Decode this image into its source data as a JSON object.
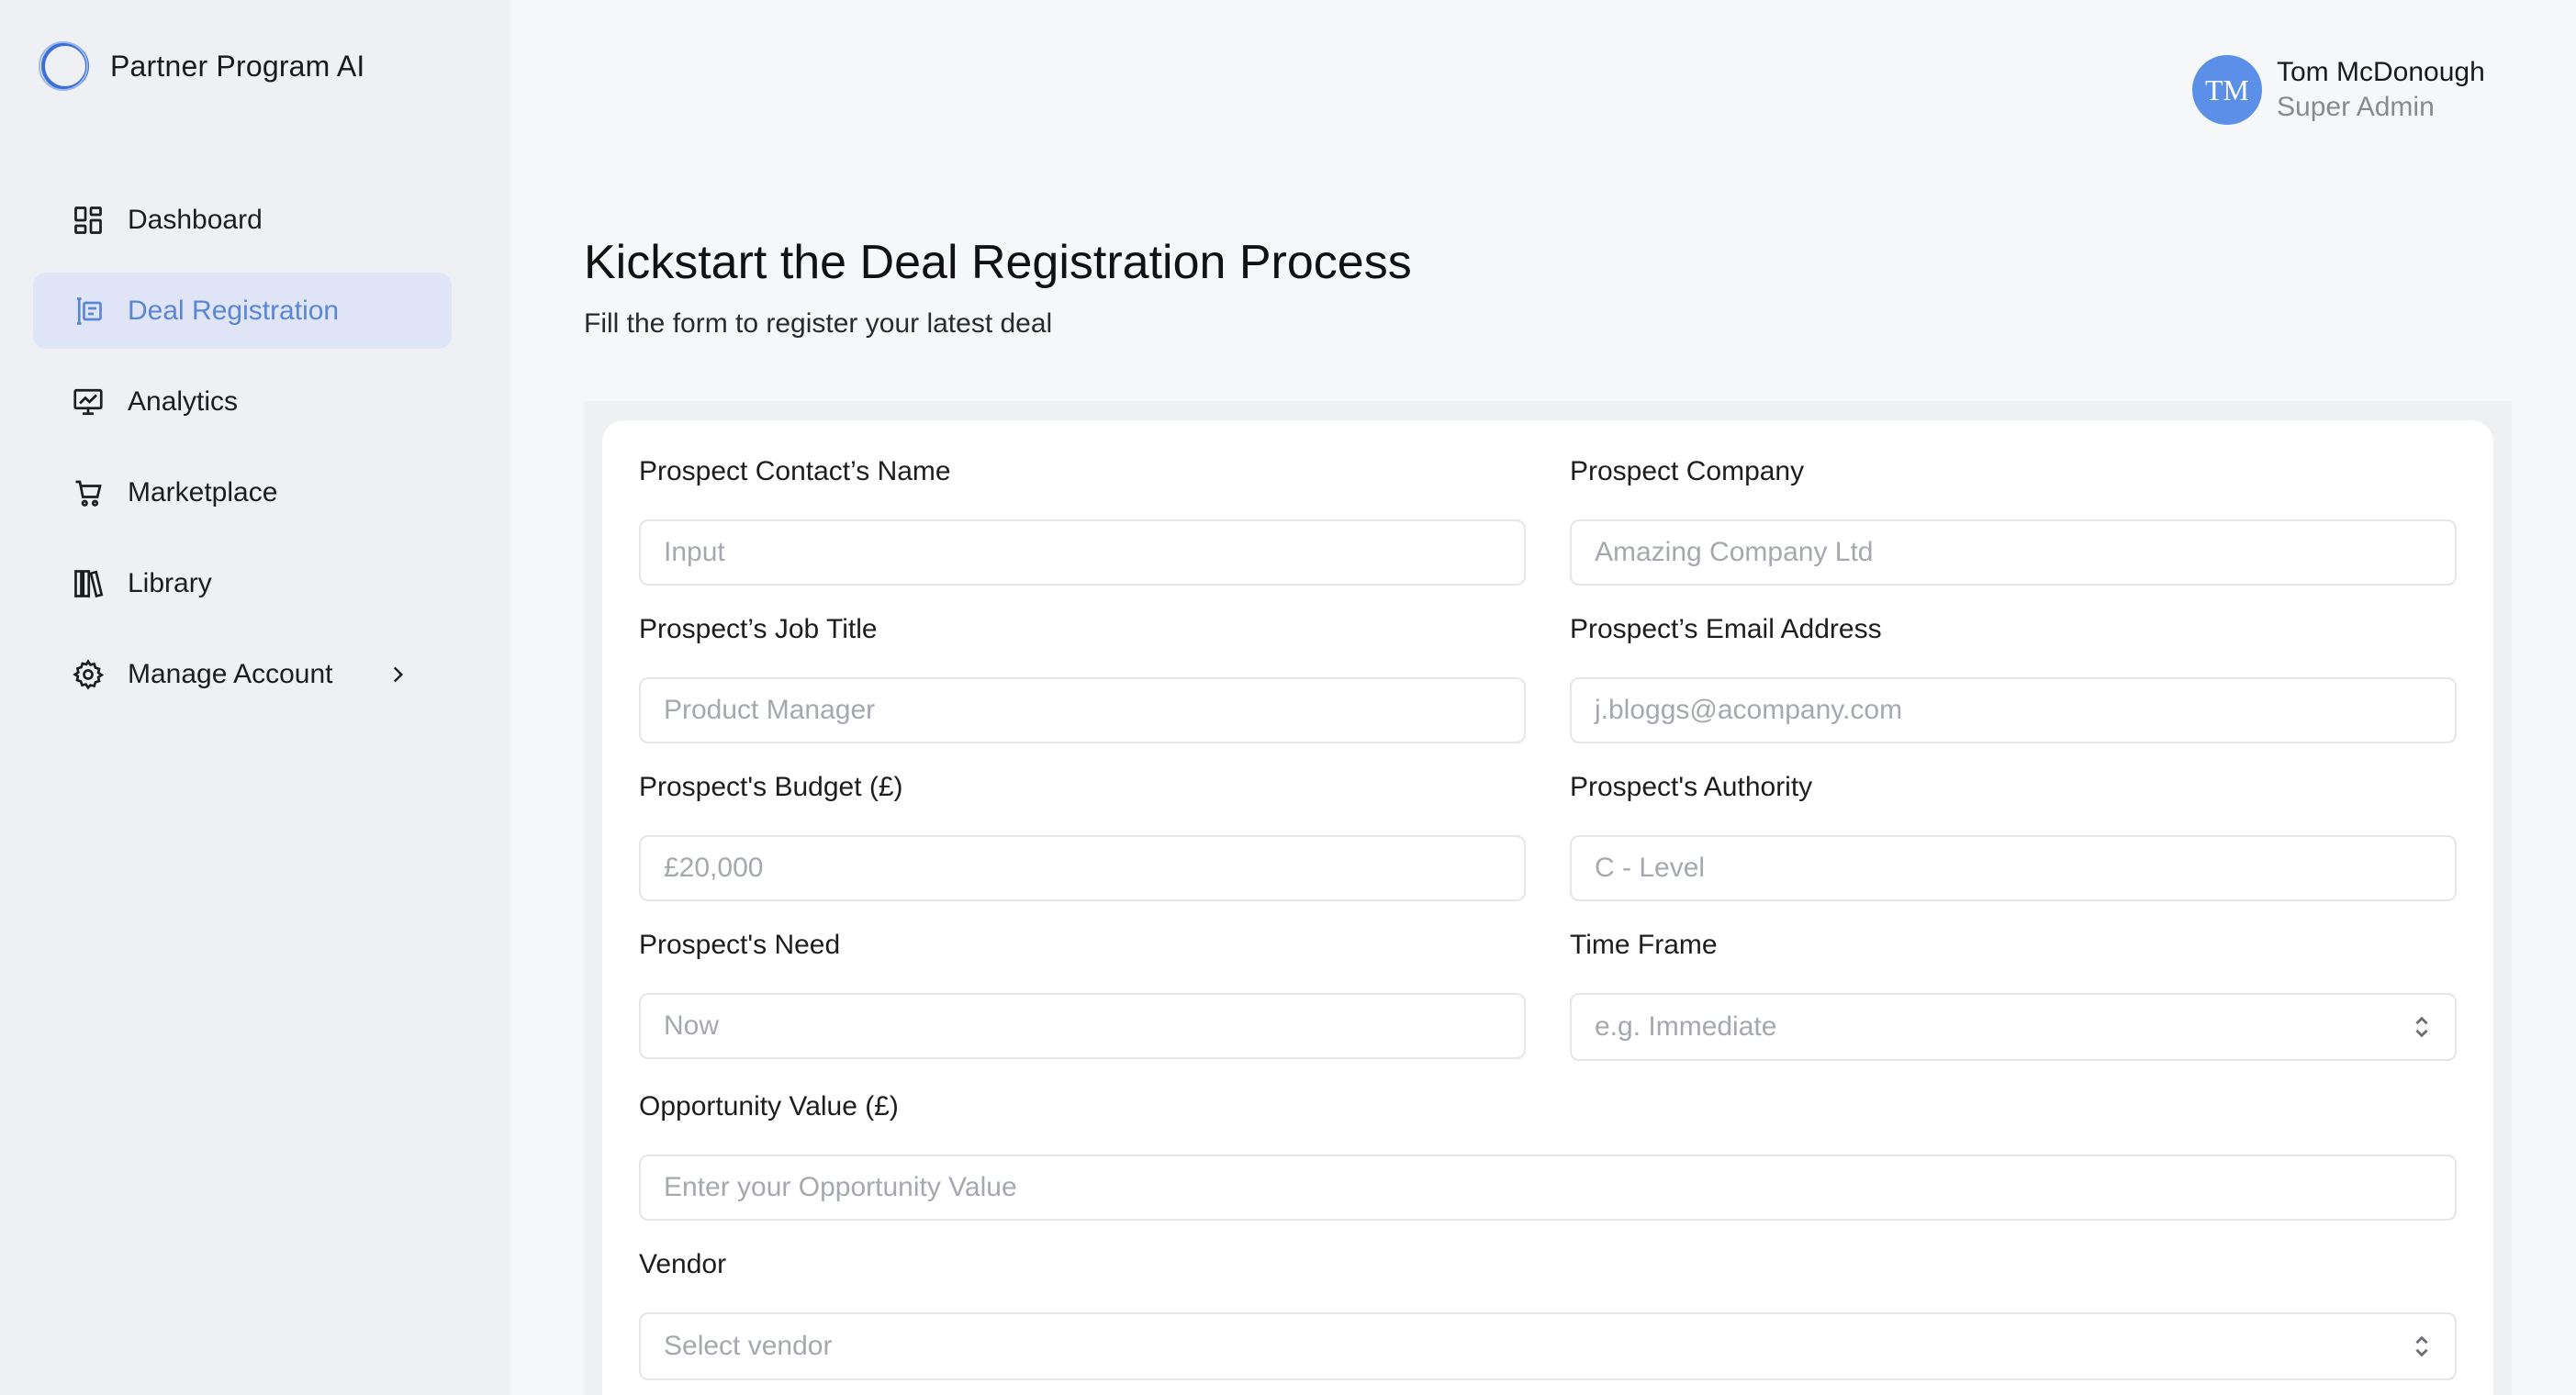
{
  "app": {
    "name": "Partner Program AI"
  },
  "user": {
    "initials": "TM",
    "name": "Tom McDonough",
    "role": "Super Admin"
  },
  "nav": [
    {
      "label": "Dashboard",
      "icon": "dashboard-icon",
      "active": false
    },
    {
      "label": "Deal Registration",
      "icon": "deal-registration-icon",
      "active": true
    },
    {
      "label": "Analytics",
      "icon": "analytics-icon",
      "active": false
    },
    {
      "label": "Marketplace",
      "icon": "cart-icon",
      "active": false
    },
    {
      "label": "Library",
      "icon": "library-icon",
      "active": false
    },
    {
      "label": "Manage Account",
      "icon": "gear-icon",
      "active": false,
      "chevron": "chevron-right-icon"
    }
  ],
  "page": {
    "title": "Kickstart the Deal Registration Process",
    "subtitle": "Fill the form to register your latest deal"
  },
  "form": {
    "contact_name": {
      "label": "Prospect Contact’s Name",
      "placeholder": "Input"
    },
    "company": {
      "label": "Prospect Company",
      "placeholder": "Amazing Company Ltd"
    },
    "job_title": {
      "label": "Prospect’s Job Title",
      "placeholder": "Product Manager"
    },
    "email": {
      "label": "Prospect’s Email Address",
      "placeholder": "j.bloggs@acompany.com"
    },
    "budget": {
      "label": "Prospect's Budget (£)",
      "placeholder": "£20,000"
    },
    "authority": {
      "label": "Prospect's Authority",
      "placeholder": "C - Level"
    },
    "need": {
      "label": "Prospect's Need",
      "placeholder": "Now"
    },
    "time_frame": {
      "label": "Time Frame",
      "placeholder": "e.g. Immediate"
    },
    "opportunity_value": {
      "label": "Opportunity Value (£)",
      "placeholder": "Enter your Opportunity Value"
    },
    "vendor": {
      "label": "Vendor",
      "placeholder": "Select vendor"
    }
  },
  "colors": {
    "accent": "#5a86d4",
    "active_bg": "#dfe5f6",
    "avatar": "#5b8fe8",
    "sidebar_bg": "#eef0f4"
  }
}
